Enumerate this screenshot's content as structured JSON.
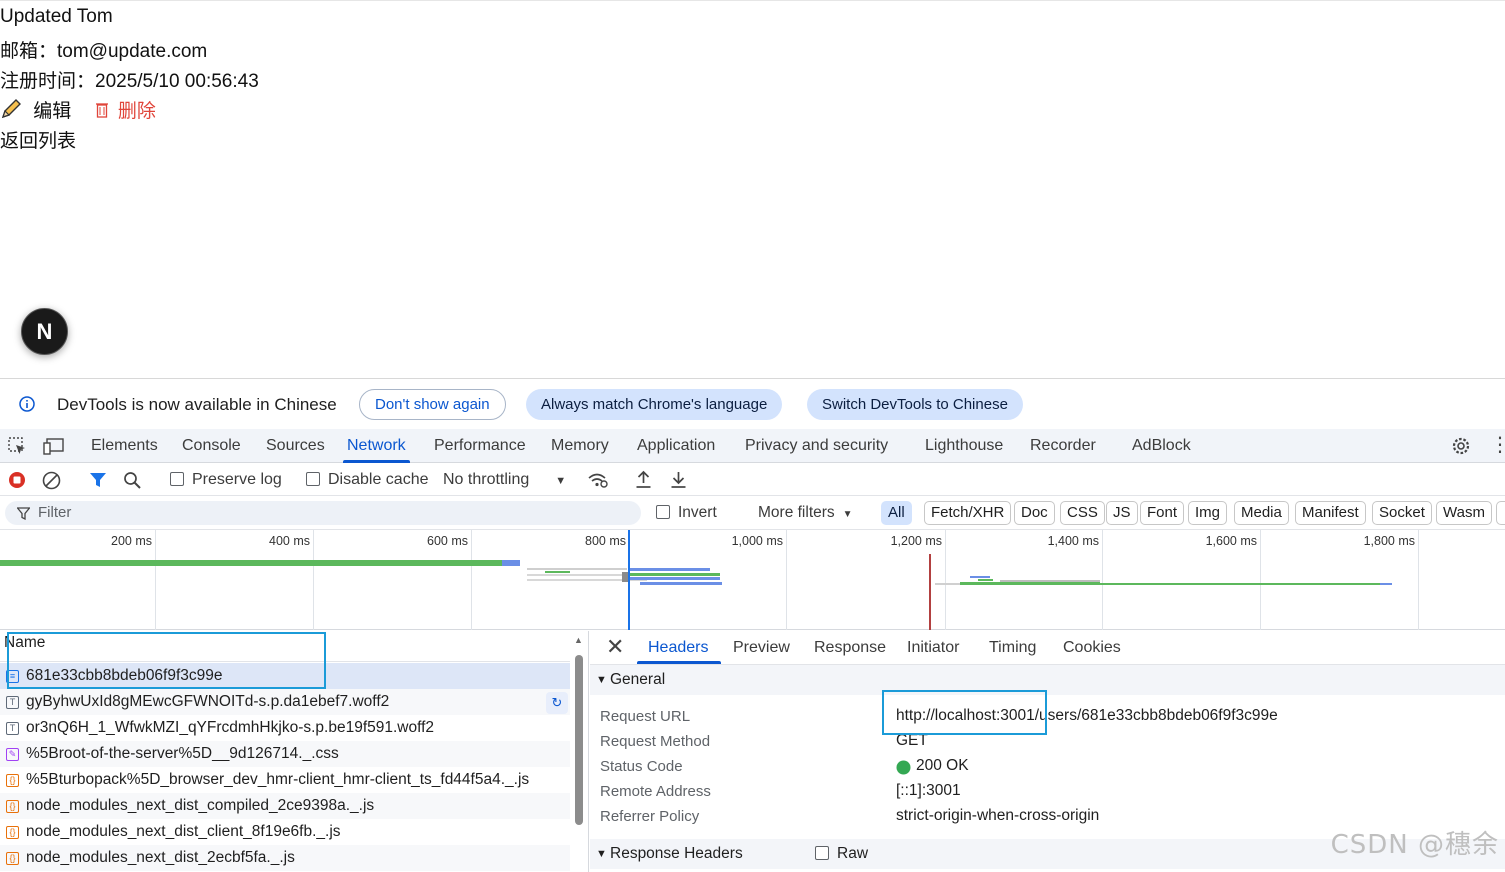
{
  "page": {
    "name": "Updated Tom",
    "email_line": "邮箱：tom@update.com",
    "registered_line": "注册时间：2025/5/10 00:56:43",
    "edit_label": "编辑",
    "delete_label": "删除",
    "back_label": "返回列表",
    "next_badge": "N"
  },
  "infobar": {
    "message": "DevTools is now available in Chinese",
    "dont_show": "Don't show again",
    "always_match": "Always match Chrome's language",
    "switch": "Switch DevTools to Chinese"
  },
  "tabs": [
    "Elements",
    "Console",
    "Sources",
    "Network",
    "Performance",
    "Memory",
    "Application",
    "Privacy and security",
    "Lighthouse",
    "Recorder",
    "AdBlock"
  ],
  "active_tab": "Network",
  "toolbar": {
    "preserve_log": "Preserve log",
    "disable_cache": "Disable cache",
    "throttling": "No throttling"
  },
  "filterbar": {
    "filter_placeholder": "Filter",
    "invert": "Invert",
    "more_filters": "More filters",
    "chips": [
      "All",
      "Fetch/XHR",
      "Doc",
      "CSS",
      "JS",
      "Font",
      "Img",
      "Media",
      "Manifest",
      "Socket",
      "Wasm"
    ]
  },
  "timeline": {
    "ticks": [
      "200 ms",
      "400 ms",
      "600 ms",
      "800 ms",
      "1,000 ms",
      "1,200 ms",
      "1,400 ms",
      "1,600 ms",
      "1,800 ms"
    ]
  },
  "requests": {
    "header": "Name",
    "rows": [
      {
        "name": "681e33cbb8bdeb06f9f3c99e",
        "type": "doc"
      },
      {
        "name": "gyByhwUxId8gMEwcGFWNOITd-s.p.da1ebef7.woff2",
        "type": "font"
      },
      {
        "name": "or3nQ6H_1_WfwkMZI_qYFrcdmhHkjko-s.p.be19f591.woff2",
        "type": "font"
      },
      {
        "name": "%5Broot-of-the-server%5D__9d126714._.css",
        "type": "css"
      },
      {
        "name": "%5Bturbopack%5D_browser_dev_hmr-client_hmr-client_ts_fd44f5a4._.js",
        "type": "js"
      },
      {
        "name": "node_modules_next_dist_compiled_2ce9398a._.js",
        "type": "js"
      },
      {
        "name": "node_modules_next_dist_client_8f19e6fb._.js",
        "type": "js"
      },
      {
        "name": "node_modules_next_dist_2ecbf5fa._.js",
        "type": "js"
      }
    ]
  },
  "details": {
    "tabs": [
      "Headers",
      "Preview",
      "Response",
      "Initiator",
      "Timing",
      "Cookies"
    ],
    "active_tab": "Headers",
    "general_title": "General",
    "general": [
      {
        "key": "Request URL",
        "value": "http://localhost:3001/users/681e33cbb8bdeb06f9f3c99e"
      },
      {
        "key": "Request Method",
        "value": "GET"
      },
      {
        "key": "Status Code",
        "value": "200 OK"
      },
      {
        "key": "Remote Address",
        "value": "[::1]:3001"
      },
      {
        "key": "Referrer Policy",
        "value": "strict-origin-when-cross-origin"
      }
    ],
    "response_headers_title": "Response Headers",
    "raw_label": "Raw"
  },
  "watermark": "CSDN @穗余",
  "colors": {
    "accent": "#0b57d0",
    "delete": "#e0453a",
    "status_ok": "#34a853",
    "highlight": "#1b9bd8"
  }
}
